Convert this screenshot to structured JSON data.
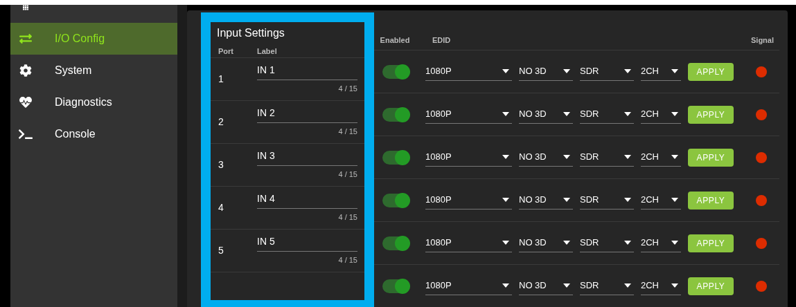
{
  "sidebar": {
    "items": [
      {
        "kind": "grid",
        "selected": false
      },
      {
        "kind": "arrows",
        "label": "I/O Config",
        "selected": true
      },
      {
        "kind": "gear",
        "label": "System",
        "selected": false
      },
      {
        "kind": "heartbeat",
        "label": "Diagnostics",
        "selected": false
      },
      {
        "kind": "terminal",
        "label": "Console",
        "selected": false
      }
    ]
  },
  "input_settings": {
    "title": "Input Settings",
    "columns": [
      "Port",
      "Label",
      "Enabled",
      "EDID",
      "Signal"
    ],
    "rows": [
      {
        "port": "1",
        "label": "IN 1",
        "counter": "4 / 15",
        "enabled": true,
        "edid": [
          "1080P",
          "NO 3D",
          "SDR",
          "2CH"
        ],
        "button": "APPLY",
        "color": "#dd2c00"
      },
      {
        "port": "2",
        "label": "IN 2",
        "counter": "4 / 15",
        "enabled": true,
        "edid": [
          "1080P",
          "NO 3D",
          "SDR",
          "2CH"
        ],
        "button": "APPLY",
        "color": "#dd2c00"
      },
      {
        "port": "3",
        "label": "IN 3",
        "counter": "4 / 15",
        "enabled": true,
        "edid": [
          "1080P",
          "NO 3D",
          "SDR",
          "2CH"
        ],
        "button": "APPLY",
        "color": "#dd2c00"
      },
      {
        "port": "4",
        "label": "IN 4",
        "counter": "4 / 15",
        "enabled": true,
        "edid": [
          "1080P",
          "NO 3D",
          "SDR",
          "2CH"
        ],
        "button": "APPLY",
        "color": "#dd2c00"
      },
      {
        "port": "5",
        "label": "IN 5",
        "counter": "4 / 15",
        "enabled": true,
        "edid": [
          "1080P",
          "NO 3D",
          "SDR",
          "2CH"
        ],
        "button": "APPLY",
        "color": "#dd2c00"
      },
      {
        "enabled": true,
        "edid": [
          "1080P",
          "NO 3D",
          "SDR",
          "2CH"
        ],
        "button": "APPLY",
        "color": "#dd2c00"
      }
    ]
  }
}
